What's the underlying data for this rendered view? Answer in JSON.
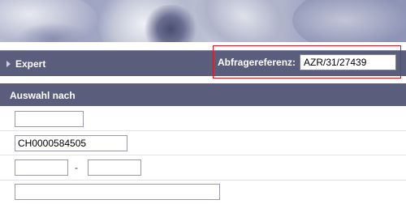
{
  "expert": {
    "label": "Expert",
    "icon": "triangle-right-icon"
  },
  "reference": {
    "label": "Abfragereferenz:",
    "value": "AZR/31/27439",
    "highlight_color": "#e0161b"
  },
  "section": {
    "title": "Auswahl nach"
  },
  "form": {
    "field1_value": "",
    "field2_value": "CH0000584505",
    "range_from_value": "",
    "range_separator": "-",
    "range_to_value": "",
    "field4_value": ""
  },
  "colors": {
    "bar": "#5b5d7d",
    "text_on_bar": "#ffffff"
  }
}
